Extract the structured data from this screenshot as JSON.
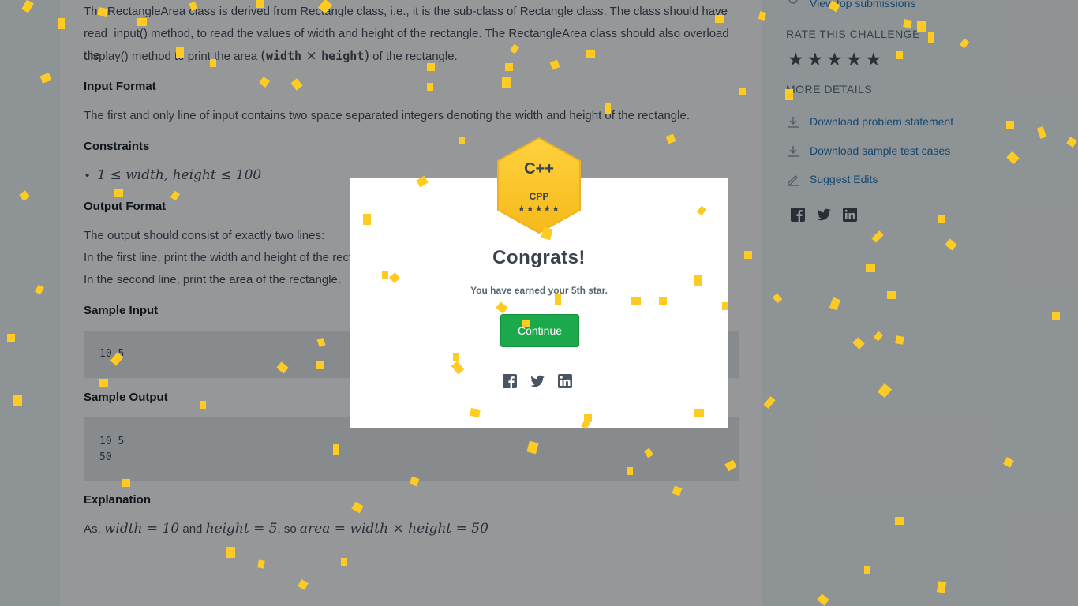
{
  "problem": {
    "intro_line1": "The RectangleArea class is derived from Rectangle class, i.e., it is the sub-class of Rectangle class. The class should have",
    "intro_line2": "read_input() method, to read the values of width and height of the rectangle. The RectangleArea class should also overload the",
    "intro_line3_pre": "display() method to print the area ",
    "intro_line3_math_open": "(",
    "intro_line3_width": "width",
    "intro_line3_times": " × ",
    "intro_line3_height": "height",
    "intro_line3_math_close": ")",
    "intro_line3_post": " of the rectangle.",
    "input_format_heading": "Input Format",
    "input_format_text": "The first and only line of input contains two space separated integers denoting the width and height of the rectangle.",
    "constraints_heading": "Constraints",
    "constraint_item": "1 ≤ width, height ≤ 100",
    "output_format_heading": "Output Format",
    "output_line1": "The output should consist of exactly two lines:",
    "output_line2": "In the first line, print the width and height of the rectangle separated by space.",
    "output_line3": "In the second line, print the area of the rectangle.",
    "sample_input_heading": "Sample Input",
    "sample_input_lines": [
      "10 5"
    ],
    "sample_output_heading": "Sample Output",
    "sample_output_lines": [
      "10 5",
      "50"
    ],
    "explanation_heading": "Explanation",
    "explanation_pre": "As, ",
    "explanation_math1": "width = 10",
    "explanation_and": " and ",
    "explanation_math2": "height = 5",
    "explanation_so": ", so ",
    "explanation_math3": "area = width × height = 50"
  },
  "sidebar": {
    "top_link": "View top submissions",
    "rate_title": "RATE THIS CHALLENGE",
    "more_title": "MORE DETAILS",
    "download_statement": "Download problem statement",
    "download_tests": "Download sample test cases",
    "suggest_edits": "Suggest Edits"
  },
  "modal": {
    "badge_logo": "C++",
    "badge_name": "CPP",
    "badge_stars": "★★★★★",
    "title": "Congrats!",
    "message": "You have earned your 5th star.",
    "continue_label": "Continue"
  },
  "icons": {
    "star": "★",
    "facebook": "facebook-icon",
    "twitter": "twitter-icon",
    "linkedin": "linkedin-icon"
  },
  "colors": {
    "accent_green": "#1ba94c",
    "badge_gold": "#f7c532",
    "link_blue": "#1a6fb5",
    "confetti": "#fdcb22"
  }
}
